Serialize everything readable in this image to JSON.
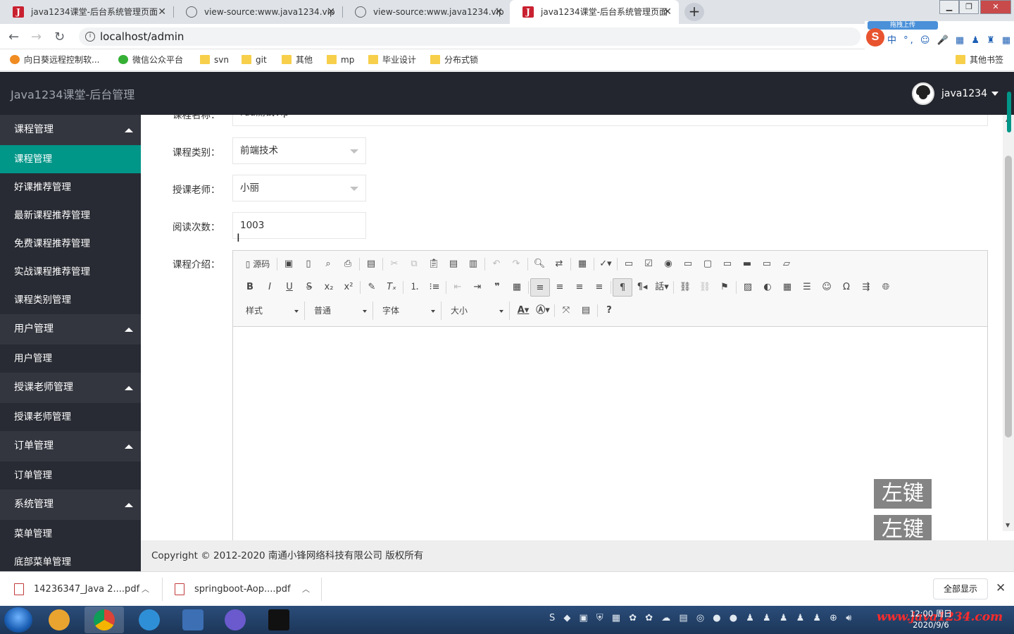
{
  "browser": {
    "tabs": [
      {
        "title": "java1234课堂-后台系统管理页面",
        "icon": "java1234-favicon",
        "active": false
      },
      {
        "title": "view-source:www.java1234.vip",
        "icon": "globe-icon",
        "active": false
      },
      {
        "title": "view-source:www.java1234.vip",
        "icon": "globe-icon",
        "active": false
      },
      {
        "title": "java1234课堂-后台系统管理页面",
        "icon": "java1234-favicon",
        "active": true
      }
    ],
    "url": "localhost/admin",
    "bookmarks": [
      "向日葵远程控制软...",
      "微信公众平台",
      "svn",
      "git",
      "其他",
      "mp",
      "毕业设计",
      "分布式锁"
    ],
    "other_bookmarks": "其他书签",
    "ime_label": "拖拽上传"
  },
  "header": {
    "title": "Java1234课堂-后台管理",
    "username": "java1234"
  },
  "sidebar": {
    "groups": [
      {
        "label": "课程管理",
        "items": [
          "课程管理",
          "好课推荐管理",
          "最新课程推荐管理",
          "免费课程推荐管理",
          "实战课程推荐管理",
          "课程类别管理"
        ]
      },
      {
        "label": "用户管理",
        "items": [
          "用户管理"
        ]
      },
      {
        "label": "授课老师管理",
        "items": [
          "授课老师管理"
        ]
      },
      {
        "label": "订单管理",
        "items": [
          "订单管理"
        ]
      },
      {
        "label": "系统管理",
        "items": [
          "菜单管理",
          "底部菜单管理"
        ]
      }
    ],
    "active_item": "课程管理"
  },
  "form": {
    "name_label": "课程名称：",
    "name_value": "rda测试vip",
    "category_label": "课程类别：",
    "category_value": "前端技术",
    "teacher_label": "授课老师：",
    "teacher_value": "小丽",
    "views_label": "阅读次数：",
    "views_value": "1003",
    "intro_label": "课程介绍："
  },
  "editor": {
    "source_label": "源码",
    "combos": {
      "style": "样式",
      "format": "普通",
      "font": "字体",
      "size": "大小"
    }
  },
  "watermarks": [
    "左键",
    "左键"
  ],
  "footer": "Copyright © 2012-2020 南通小锋网络科技有限公司 版权所有",
  "downloads": {
    "items": [
      "14236347_Java 2....pdf",
      "springboot-Aop....pdf"
    ],
    "show_all": "全部显示"
  },
  "taskbar": {
    "time": "12:00 周日",
    "date": "2020/9/6",
    "site": "www.java1234.com"
  }
}
